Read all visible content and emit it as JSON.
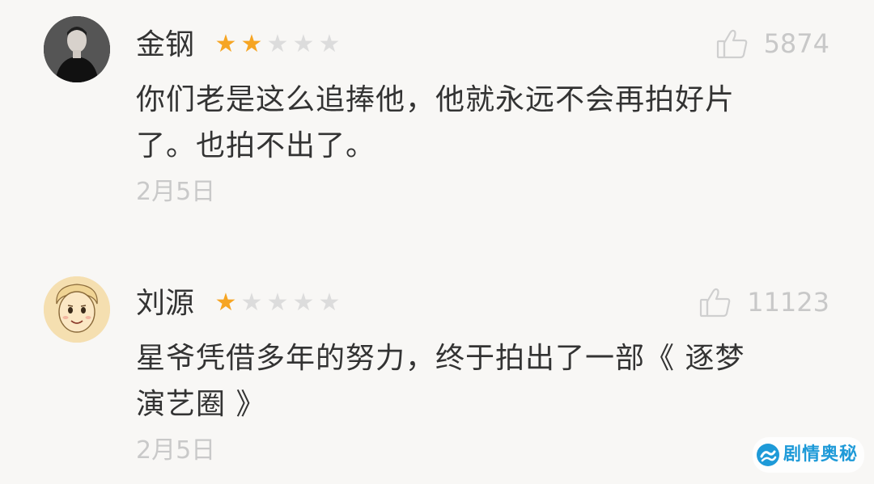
{
  "comments": [
    {
      "user": "金钢",
      "rating": 2,
      "max_rating": 5,
      "likes": "5874",
      "text_lines": [
        "你们老是这么追捧他，他就永远不会再拍好片",
        "了。也拍不出了。"
      ],
      "date": "2月5日",
      "avatar": "man-portrait-avatar"
    },
    {
      "user": "刘源",
      "rating": 1,
      "max_rating": 5,
      "likes": "11123",
      "text_lines": [
        "星爷凭借多年的努力，终于拍出了一部《 逐梦",
        "演艺圈 》"
      ],
      "date": "2月5日",
      "avatar": "cartoon-boy-avatar"
    }
  ],
  "watermark": {
    "text": "剧情奥秘",
    "icon": "wave-logo-icon"
  },
  "colors": {
    "star_on": "#f6a523",
    "star_off": "#dcdcdc",
    "text": "#333333",
    "muted": "#c8c8c8",
    "background": "#f8f7f5",
    "watermark": "#1e9ad8"
  }
}
